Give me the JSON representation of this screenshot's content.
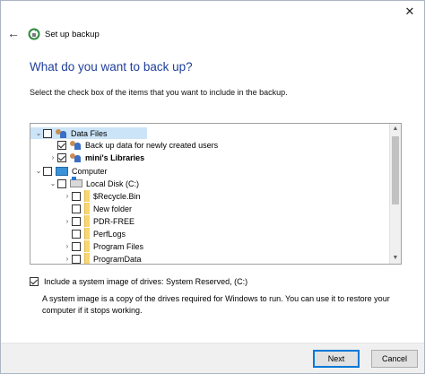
{
  "window": {
    "title": "Set up backup",
    "close_glyph": "✕",
    "back_glyph": "←"
  },
  "page": {
    "heading": "What do you want to back up?",
    "instruction": "Select the check box of the items that you want to include in the backup."
  },
  "tree": {
    "items": [
      {
        "label": "Data Files",
        "checked": false,
        "icon": "users-icon",
        "expander": "chevron-down-icon",
        "selected": true
      },
      {
        "label": "Back up data for newly created users",
        "checked": true,
        "icon": "users-icon",
        "expander": ""
      },
      {
        "label": "mini's Libraries",
        "checked": true,
        "icon": "users-icon",
        "expander": "chevron-right-icon"
      },
      {
        "label": "Computer",
        "checked": false,
        "icon": "computer-icon",
        "expander": "chevron-down-icon"
      },
      {
        "label": "Local Disk (C:)",
        "checked": false,
        "icon": "drive-icon",
        "expander": "chevron-down-icon"
      },
      {
        "label": "$Recycle.Bin",
        "checked": false,
        "icon": "folder-icon",
        "expander": "chevron-right-icon"
      },
      {
        "label": "New folder",
        "checked": false,
        "icon": "folder-icon",
        "expander": ""
      },
      {
        "label": "PDR-FREE",
        "checked": false,
        "icon": "folder-icon",
        "expander": "chevron-right-icon"
      },
      {
        "label": "PerfLogs",
        "checked": false,
        "icon": "folder-icon",
        "expander": ""
      },
      {
        "label": "Program Files",
        "checked": false,
        "icon": "folder-icon",
        "expander": "chevron-right-icon"
      },
      {
        "label": "ProgramData",
        "checked": false,
        "icon": "folder-icon",
        "expander": "chevron-right-icon"
      }
    ]
  },
  "system_image": {
    "checked": true,
    "label": "Include a system image of drives: System Reserved, (C:)",
    "description": "A system image is a copy of the drives required for Windows to run. You can use it to restore your computer if it stops working."
  },
  "buttons": {
    "next": "Next",
    "cancel": "Cancel"
  },
  "colors": {
    "heading": "#1f3f9a",
    "selection": "#cce4f7",
    "primary_button_border": "#0078d7"
  }
}
